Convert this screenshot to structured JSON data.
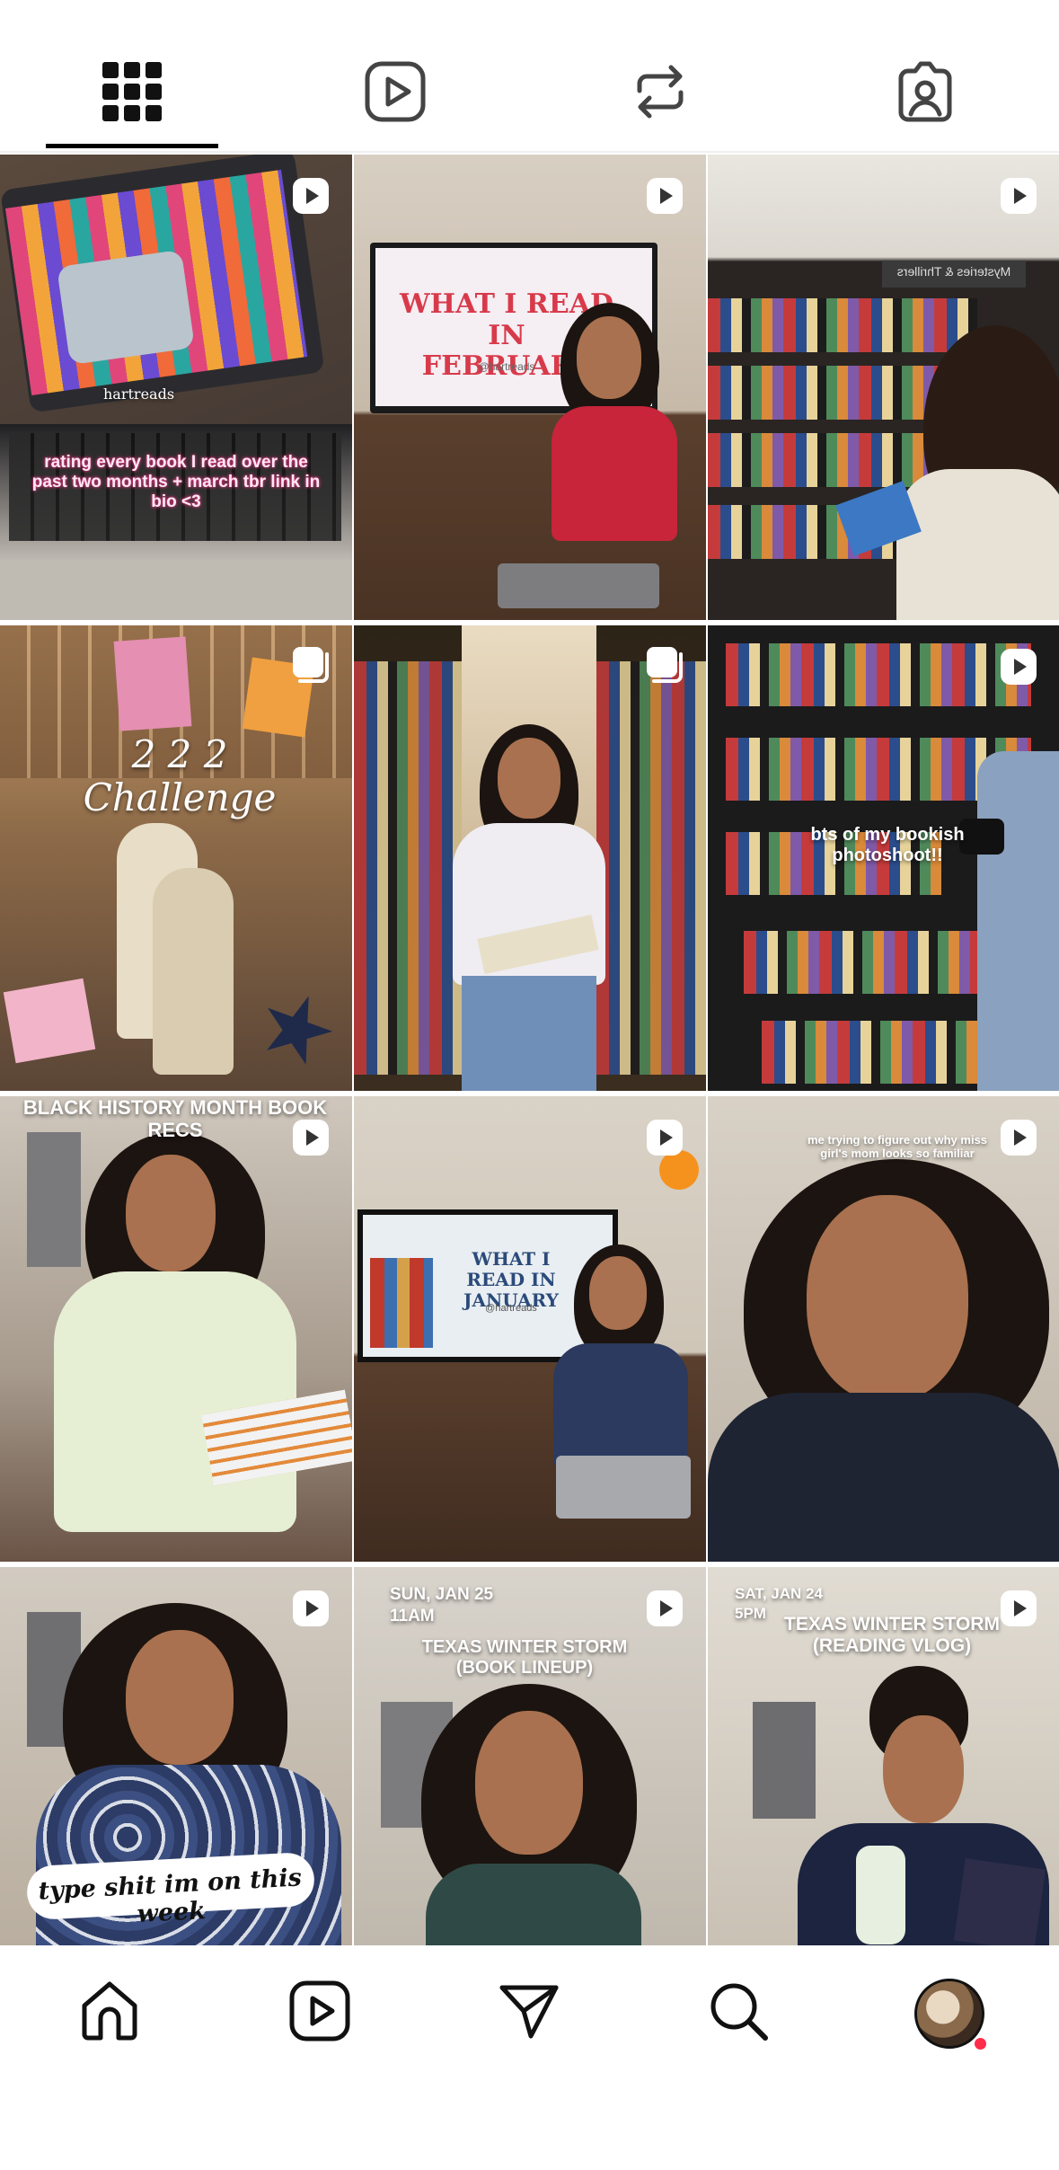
{
  "tabs": [
    {
      "name": "posts-grid",
      "icon": "grid-icon",
      "active": true
    },
    {
      "name": "reels",
      "icon": "reels-icon",
      "active": false
    },
    {
      "name": "reposts",
      "icon": "repost-icon",
      "active": false
    },
    {
      "name": "tagged",
      "icon": "tagged-user-icon",
      "active": false
    }
  ],
  "grid": {
    "posts": [
      {
        "type": "reel",
        "caption": "rating every book I read over the past two months + march tbr link in bio <3",
        "overlay": "hartreads"
      },
      {
        "type": "reel",
        "caption": "",
        "overlay": "WHAT I READ IN FEBRUARY",
        "overlay_sub": "@hartreads"
      },
      {
        "type": "reel",
        "caption": "",
        "overlay": "Mysteries & Thrillers"
      },
      {
        "type": "carousel",
        "caption": "",
        "overlay": "2 2 2 Challenge"
      },
      {
        "type": "carousel",
        "caption": ""
      },
      {
        "type": "reel",
        "caption": "bts of my bookish photoshoot!!"
      },
      {
        "type": "reel",
        "caption": "BLACK HISTORY MONTH BOOK RECS"
      },
      {
        "type": "reel",
        "caption": "",
        "overlay": "WHAT I READ IN JANUARY",
        "overlay_sub": "@hartreads"
      },
      {
        "type": "reel",
        "caption": "me trying to figure out why miss girl's mom looks so familiar"
      },
      {
        "type": "reel",
        "caption": "type shit im on this week"
      },
      {
        "type": "reel",
        "date": "SUN, JAN 25",
        "time": "11AM",
        "caption": "TEXAS WINTER STORM (BOOK LINEUP)"
      },
      {
        "type": "reel",
        "date": "SAT, JAN 24",
        "time": "5PM",
        "caption": "TEXAS WINTER STORM (READING VLOG)"
      }
    ]
  },
  "bottom_nav": [
    {
      "name": "home",
      "icon": "home-icon"
    },
    {
      "name": "reels",
      "icon": "reels-icon"
    },
    {
      "name": "direct-messages",
      "icon": "send-icon"
    },
    {
      "name": "search",
      "icon": "search-icon"
    },
    {
      "name": "profile",
      "icon": "avatar"
    }
  ],
  "colors": {
    "accent": "#000000",
    "notification_dot": "#ff2c4c",
    "background": "#ffffff"
  }
}
